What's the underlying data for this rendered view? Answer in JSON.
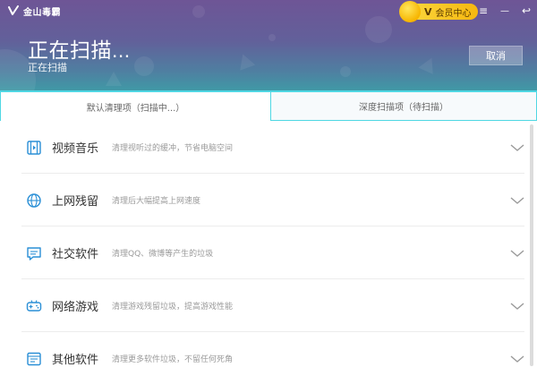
{
  "app": {
    "logo_text": "金山毒霸"
  },
  "header": {
    "title": "正在扫描...",
    "subtitle": "正在扫描",
    "vip_badge": "V",
    "vip_label": "会员中心",
    "cancel_label": "取消",
    "menu_icon": "≡",
    "minimize_icon": "—",
    "back_icon": "↩"
  },
  "tabs": [
    {
      "label": "默认清理项（扫描中...）"
    },
    {
      "label": "深度扫描项（待扫描）"
    }
  ],
  "items": [
    {
      "icon": "video-icon",
      "name": "视频音乐",
      "desc": "清理视听过的缓冲，节省电脑空间"
    },
    {
      "icon": "globe-icon",
      "name": "上网残留",
      "desc": "清理后大幅提高上网速度"
    },
    {
      "icon": "chat-icon",
      "name": "社交软件",
      "desc": "清理QQ、微博等产生的垃圾"
    },
    {
      "icon": "gamepad-icon",
      "name": "网络游戏",
      "desc": "清理游戏残留垃圾，提高游戏性能"
    },
    {
      "icon": "app-window-icon",
      "name": "其他软件",
      "desc": "清理更多软件垃圾，不留任何死角"
    }
  ],
  "colors": {
    "accent": "#4fd7e3",
    "icon_blue": "#2a8fd6",
    "header_top": "#6e5596",
    "header_bottom": "#3f9aa6"
  }
}
